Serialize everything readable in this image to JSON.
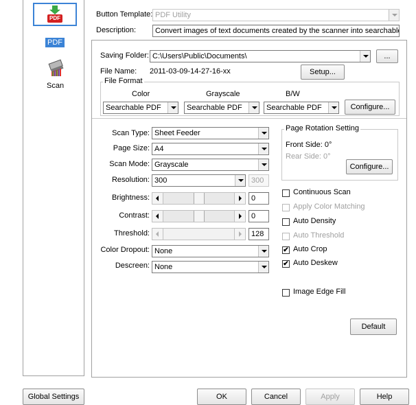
{
  "left_panel": {
    "templates": [
      {
        "label": "PDF",
        "icon": "pdf-icon",
        "badge": "PDF",
        "selected": true
      },
      {
        "label": "Scan",
        "icon": "scanner-icon",
        "selected": false
      }
    ]
  },
  "header": {
    "template_label": "Button Template:",
    "template_value": "PDF Utility",
    "description_label": "Description:",
    "description_value": "Convert images of text documents created by the scanner into searchable pdf or p"
  },
  "saving": {
    "folder_label": "Saving Folder:",
    "folder_value": "C:\\Users\\Public\\Documents\\",
    "browse_label": "...",
    "filename_label": "File Name:",
    "filename_value": "2011-03-09-14-27-16-xx",
    "setup_label": "Setup..."
  },
  "file_format": {
    "title": "File Format",
    "color_label": "Color",
    "gray_label": "Grayscale",
    "bw_label": "B/W",
    "color_value": "Searchable PDF",
    "gray_value": "Searchable PDF",
    "bw_value": "Searchable PDF",
    "configure_label": "Configure..."
  },
  "scan": {
    "scan_type_label": "Scan Type:",
    "scan_type_value": "Sheet Feeder",
    "page_size_label": "Page Size:",
    "page_size_value": "A4",
    "scan_mode_label": "Scan Mode:",
    "scan_mode_value": "Grayscale",
    "resolution_label": "Resolution:",
    "resolution_value": "300",
    "resolution_secondary": "300",
    "brightness_label": "Brightness:",
    "brightness_value": "0",
    "contrast_label": "Contrast:",
    "contrast_value": "0",
    "threshold_label": "Threshold:",
    "threshold_value": "128",
    "color_dropout_label": "Color Dropout:",
    "color_dropout_value": "None",
    "descreen_label": "Descreen:",
    "descreen_value": "None"
  },
  "rotation": {
    "title": "Page Rotation Setting",
    "front_label": "Front Side: 0°",
    "rear_label": "Rear Side: 0°",
    "configure_label": "Configure..."
  },
  "options": {
    "continuous_scan": "Continuous Scan",
    "apply_color_matching": "Apply Color Matching",
    "auto_density": "Auto Density",
    "auto_threshold": "Auto Threshold",
    "auto_crop": "Auto Crop",
    "auto_deskew": "Auto Deskew",
    "image_edge_fill": "Image Edge Fill",
    "check_mark": "✔",
    "default_label": "Default"
  },
  "footer": {
    "global_settings": "Global Settings",
    "ok": "OK",
    "cancel": "Cancel",
    "apply": "Apply",
    "help": "Help"
  }
}
